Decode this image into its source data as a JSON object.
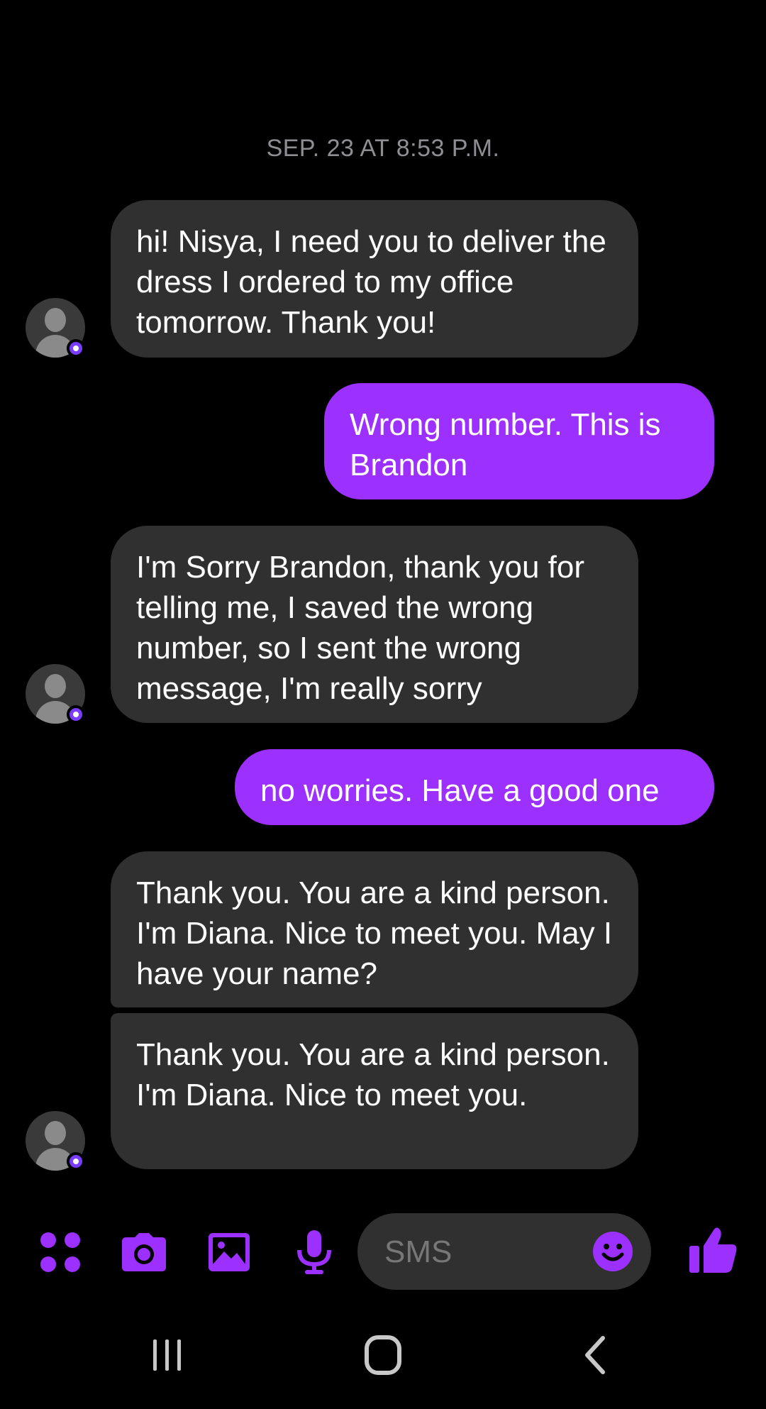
{
  "conversation": {
    "timestamp": "SEP. 23 AT 8:53 P.M.",
    "messages": [
      {
        "direction": "incoming",
        "text": "hi! Nisya, I need you to deliver the dress I ordered to my office tomorrow. Thank you!"
      },
      {
        "direction": "outgoing",
        "text": "Wrong number. This is Brandon"
      },
      {
        "direction": "incoming",
        "text": "I'm Sorry Brandon, thank you for telling me, I saved the wrong number, so I sent the wrong message, I'm really sorry"
      },
      {
        "direction": "outgoing",
        "text": "no worries. Have a good one"
      },
      {
        "direction": "incoming",
        "text": "Thank you. You are a kind person. I'm Diana. Nice to meet you. May I have your name?"
      },
      {
        "direction": "incoming",
        "text": "Thank you. You are a kind person. I'm Diana. Nice to meet you."
      }
    ]
  },
  "composer": {
    "placeholder": "SMS",
    "icons": [
      "apps-icon",
      "camera-icon",
      "image-icon",
      "microphone-icon",
      "emoji-icon",
      "thumbs-up-icon"
    ]
  },
  "system_nav": {
    "icons": [
      "recent-apps-icon",
      "home-icon",
      "back-icon"
    ]
  },
  "colors": {
    "background": "#000000",
    "incoming_bubble": "#303030",
    "outgoing_bubble": "#9b30ff",
    "accent": "#9b30ff",
    "timestamp_text": "#8e8e93"
  }
}
